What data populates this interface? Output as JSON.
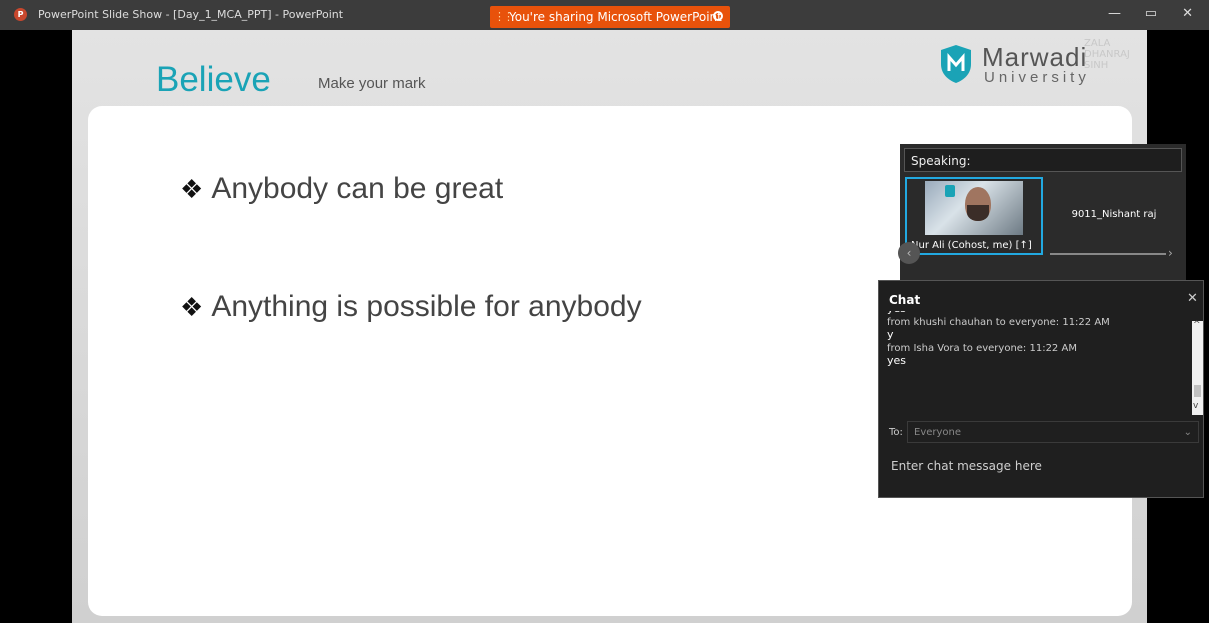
{
  "window": {
    "app_icon_letter": "P",
    "title": "PowerPoint Slide Show - [Day_1_MCA_PPT] - PowerPoint",
    "share_banner": "You're sharing Microsoft PowerPoint",
    "controls": {
      "minimize": "—",
      "restore": "▭",
      "close": "✕"
    }
  },
  "slide": {
    "title": "Believe",
    "subtitle": "Make your mark",
    "logo": {
      "name": "Marwadi",
      "sub": "University"
    },
    "watermark": "ZALA DHANRAJ SINH",
    "bullets": [
      {
        "mark": "❖",
        "text": "Anybody can be great"
      },
      {
        "mark": "❖",
        "text": "Anything is possible for anybody"
      }
    ]
  },
  "video_panel": {
    "speaking_label": "Speaking:",
    "participants": [
      {
        "name": "Nur Ali  (Cohost, me)"
      },
      {
        "name": "9011_Nishant raj"
      }
    ]
  },
  "chat": {
    "header": "Chat",
    "messages": [
      {
        "meta": "",
        "body": "yes"
      },
      {
        "meta": "from khushi chauhan to everyone:   11:22 AM",
        "body": "y"
      },
      {
        "meta": "from Isha Vora to everyone:   11:22 AM",
        "body": "yes"
      }
    ],
    "to_label": "To:",
    "to_value": "Everyone",
    "input_placeholder": "Enter chat message here"
  },
  "colors": {
    "accent_teal": "#1aa3b6",
    "share_orange": "#e8520b",
    "active_tile_border": "#22a9e1"
  }
}
